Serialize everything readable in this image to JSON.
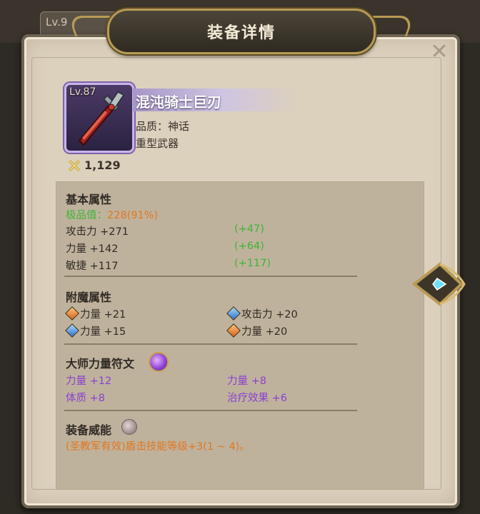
{
  "background": {
    "card_text": "Lv.9"
  },
  "header": {
    "title": "装备详情"
  },
  "item": {
    "level": "Lv.87",
    "name": "混沌骑士巨刃",
    "quality": "品质：神话",
    "type": "重型武器",
    "power": "1,129"
  },
  "basic": {
    "heading": "基本属性",
    "rating_label": "极品值：",
    "rating_value": "228(91%)",
    "rows": [
      {
        "label": "攻击力 +271",
        "bonus": "(+47)"
      },
      {
        "label": "力量 +142",
        "bonus": "(+64)"
      },
      {
        "label": "敏捷 +117",
        "bonus": "(+117)"
      }
    ]
  },
  "enchant": {
    "heading": "附魔属性",
    "items": [
      {
        "gem": "orange-gem-icon",
        "text": "力量 +21"
      },
      {
        "gem": "blue-gem-icon",
        "text": "攻击力 +20"
      },
      {
        "gem": "blue-gem-icon",
        "text": "力量 +15"
      },
      {
        "gem": "orange-gem-icon",
        "text": "力量 +20"
      }
    ]
  },
  "rune": {
    "heading": "大师力量符文",
    "icon": "purple-rune-icon",
    "items": [
      "力量 +12",
      "力量 +8",
      "体质 +8",
      "治疗效果 +6"
    ]
  },
  "might": {
    "heading": "装备威能",
    "icon": "stone-orb-icon",
    "text": "(圣教军有效)盾击技能等级+3(1 ~ 4)。"
  },
  "colors": {
    "green": "#3db536",
    "orange": "#e2771e",
    "purple": "#8a3fd1",
    "frame_gold": "#b89a55",
    "item_frame": "#c9b5ec"
  }
}
